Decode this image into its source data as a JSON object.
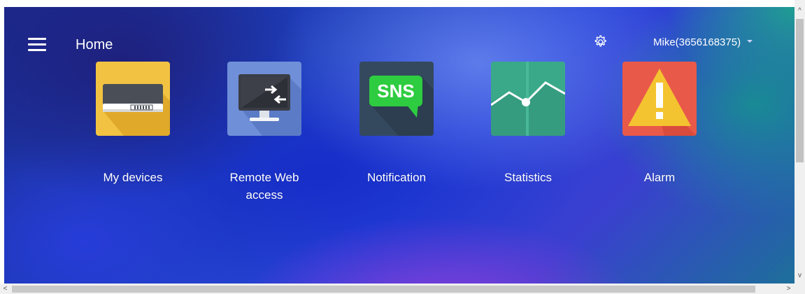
{
  "header": {
    "title": "Home",
    "menu_icon": "hamburger-menu-icon",
    "settings_icon": "gear-icon",
    "user_label": "Mike(3656168375)"
  },
  "tiles": [
    {
      "label": "My devices",
      "icon": "router-device-icon",
      "color": "#f2c342"
    },
    {
      "label": "Remote Web access",
      "icon": "remote-monitor-icon",
      "color": "#6f8fd8"
    },
    {
      "label": "Notification",
      "icon": "sns-message-icon",
      "color": "#34495e",
      "icon_text": "SNS",
      "accent": "#2ecc40"
    },
    {
      "label": "Statistics",
      "icon": "line-chart-icon",
      "color": "#3aa98a"
    },
    {
      "label": "Alarm",
      "icon": "warning-triangle-icon",
      "color": "#e9594a",
      "accent": "#f4c430"
    }
  ],
  "scrollbars": {
    "up": "^",
    "down": "v",
    "left": "<",
    "right": ">"
  }
}
